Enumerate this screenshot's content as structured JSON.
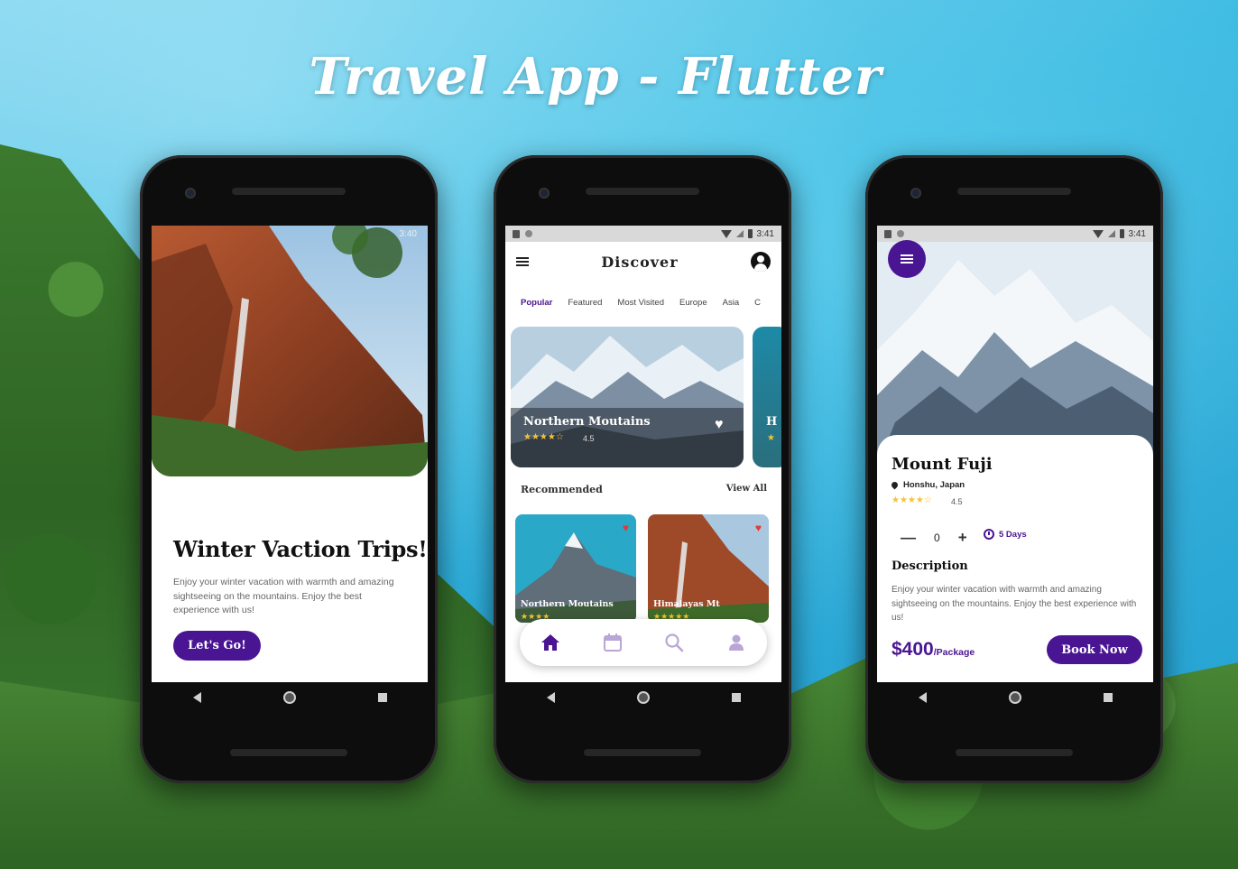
{
  "banner": {
    "title": "Travel App  - Flutter"
  },
  "colors": {
    "accent": "#4a1592",
    "star": "#f4c430",
    "heart": "#e53935"
  },
  "phone1": {
    "status_time": "3:40",
    "title": "Winter Vaction Trips!",
    "description": "Enjoy your winter vacation with warmth and amazing sightseeing on the mountains. Enjoy the best experience with us!",
    "button_label": "Let's Go!"
  },
  "phone2": {
    "status_time": "3:41",
    "header_title": "Discover",
    "tabs": [
      "Popular",
      "Featured",
      "Most Visited",
      "Europe",
      "Asia",
      "C"
    ],
    "featured_card": {
      "title": "Northern Moutains",
      "rating": "4.5",
      "stars": "★★★★☆"
    },
    "peek_card": {
      "letter": "H",
      "stars": "★"
    },
    "recommended_label": "Recommended",
    "view_all_label": "View All",
    "recommended": [
      {
        "title": "Northern Moutains",
        "stars": "★★★★"
      },
      {
        "title": "Himalayas Mt",
        "stars": "★★★★★"
      }
    ],
    "bottom_nav": [
      "home-icon",
      "calendar-icon",
      "search-icon",
      "person-icon"
    ]
  },
  "phone3": {
    "status_time": "3:41",
    "title": "Mount Fuji",
    "location": "Honshu, Japan",
    "stars": "★★★★☆",
    "rating": "4.5",
    "quantity": "0",
    "minus": "—",
    "plus": "+",
    "days": "5 Days",
    "description_label": "Description",
    "description": "Enjoy your winter vacation with warmth and amazing sightseeing on the mountains. Enjoy the best experience with us!",
    "price": "$400",
    "price_unit": "/Package",
    "book_label": "Book Now"
  }
}
